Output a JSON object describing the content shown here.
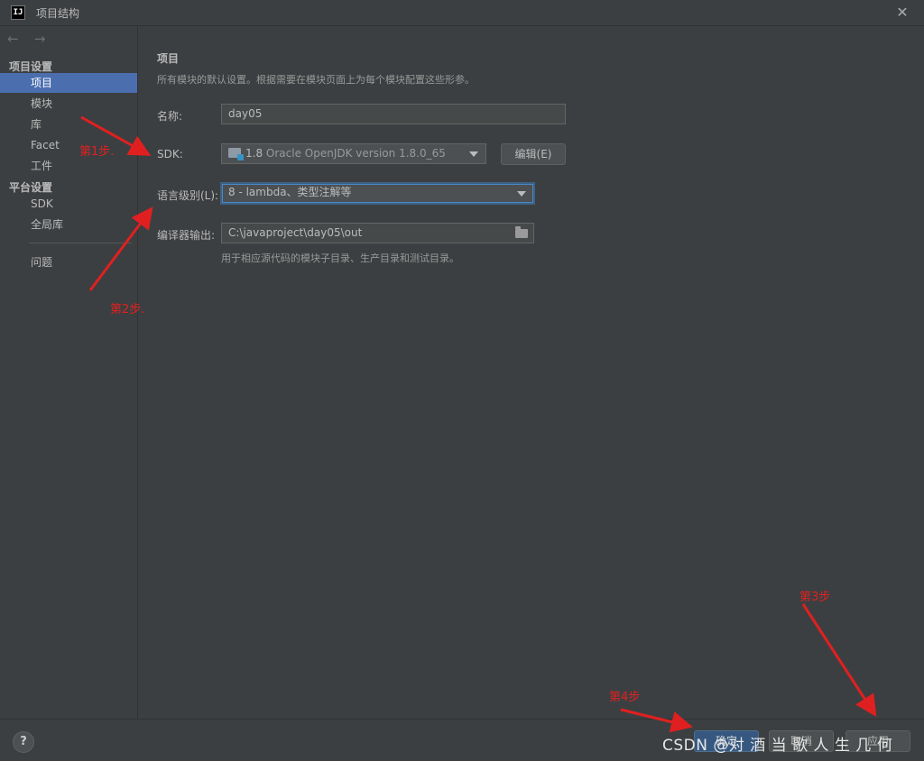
{
  "window": {
    "logo_text": "IJ",
    "title": "项目结构",
    "close_glyph": "✕"
  },
  "sidebar": {
    "back_glyph": "←",
    "forward_glyph": "→",
    "section_project": "项目设置",
    "items": [
      {
        "label": "项目",
        "selected": true
      },
      {
        "label": "模块"
      },
      {
        "label": "库"
      },
      {
        "label": "Facet"
      },
      {
        "label": "工件"
      }
    ],
    "section_platform": "平台设置",
    "platform_items": [
      {
        "label": "SDK"
      },
      {
        "label": "全局库"
      }
    ],
    "problems_label": "问题"
  },
  "main": {
    "title": "项目",
    "description": "所有模块的默认设置。根据需要在模块页面上为每个模块配置这些形参。",
    "name_label": "名称:",
    "name_value": "day05",
    "sdk_label": "SDK:",
    "sdk_version": "1.8",
    "sdk_description": "Oracle OpenJDK version 1.8.0_65",
    "edit_button": "编辑(E)",
    "language_level_label": "语言级别(L):",
    "language_level_value": "8 - lambda、类型注解等",
    "compiler_output_label": "编译器输出:",
    "compiler_output_value": "C:\\javaproject\\day05\\out",
    "compiler_output_hint": "用于相应源代码的模块子目录、生产目录和测试目录。"
  },
  "bottom": {
    "help": "?",
    "ok": "确定",
    "cancel": "取消",
    "apply": "应用",
    "watermark": "CSDN @对 酒 当 歌 人 生 几 何"
  },
  "annotations": {
    "step1": "第1步.",
    "step2": "第2步.",
    "step3": "第3步",
    "step4": "第4步"
  },
  "colors": {
    "background": "#3c3f41",
    "selection": "#4b6eaf",
    "annotation": "#e02020",
    "focus_border": "#3d6185"
  }
}
